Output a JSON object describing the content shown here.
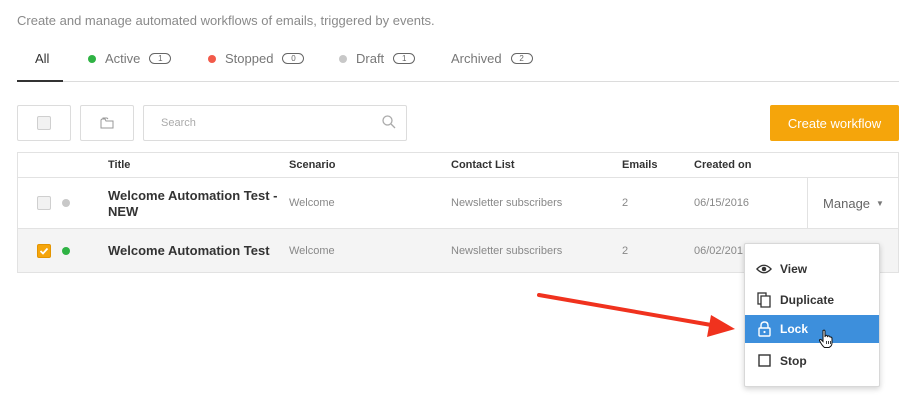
{
  "header": {
    "subtitle": "Create and manage automated workflows of emails, triggered by events."
  },
  "tabs": [
    {
      "label": "All",
      "count": "",
      "dot_color": ""
    },
    {
      "label": "Active",
      "count": "1",
      "dot_color": "#2fb344"
    },
    {
      "label": "Stopped",
      "count": "0",
      "dot_color": "#f25a4a"
    },
    {
      "label": "Draft",
      "count": "1",
      "dot_color": "#c8c8c8"
    },
    {
      "label": "Archived",
      "count": "2",
      "dot_color": ""
    }
  ],
  "toolbar": {
    "search_placeholder": "Search",
    "create_label": "Create workflow"
  },
  "table": {
    "columns": [
      "Title",
      "Scenario",
      "Contact List",
      "Emails",
      "Created on"
    ],
    "rows": [
      {
        "title_line1": "Welcome Automation Test -",
        "title_line2": "NEW",
        "scenario": "Welcome",
        "contact_list": "Newsletter subscribers",
        "emails": "2",
        "created_on": "06/15/2016",
        "checked": false,
        "status_color": "#c8c8c8",
        "action_label": "Manage"
      },
      {
        "title": "Welcome Automation Test",
        "scenario": "Welcome",
        "contact_list": "Newsletter subscribers",
        "emails": "2",
        "created_on": "06/02/201",
        "checked": true,
        "status_color": "#2fb344"
      }
    ]
  },
  "dropdown": {
    "items": [
      {
        "label": "View",
        "icon": "eye-icon"
      },
      {
        "label": "Duplicate",
        "icon": "copy-icon"
      },
      {
        "label": "Lock",
        "icon": "lock-icon",
        "highlighted": true
      },
      {
        "label": "Stop",
        "icon": "stop-icon"
      }
    ]
  },
  "colors": {
    "accent": "#f5a50b",
    "highlight": "#3d8fdc",
    "annotation_arrow": "#f0321e"
  }
}
